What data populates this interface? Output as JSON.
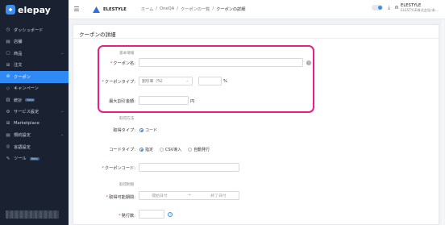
{
  "sidebar": {
    "brand": "elepay",
    "items": [
      {
        "label": "ダッシュボード",
        "icon": "clock-icon"
      },
      {
        "label": "店舗",
        "icon": "store-icon"
      },
      {
        "label": "商品",
        "icon": "box-icon",
        "expandable": true
      },
      {
        "label": "注文",
        "icon": "cart-icon"
      },
      {
        "label": "クーポン",
        "icon": "coupon-icon",
        "active": true
      },
      {
        "label": "キャンペーン",
        "icon": "tag-icon"
      },
      {
        "label": "統計",
        "icon": "chart-icon",
        "badge": "Beta"
      },
      {
        "label": "サービス設定",
        "icon": "gear-icon",
        "expandable": true
      },
      {
        "label": "Marketplace",
        "icon": "grid-icon"
      },
      {
        "label": "規約設定",
        "icon": "doc-icon",
        "expandable": true
      },
      {
        "label": "言語設定",
        "icon": "globe-icon"
      },
      {
        "label": "ツール",
        "icon": "wrench-icon",
        "badge": "Beta"
      }
    ]
  },
  "topbar": {
    "brand": "ELESTYLE",
    "breadcrumbs": [
      "ホーム",
      "/",
      "OneQA",
      "/",
      "クーポンの一覧",
      "/",
      "クーポンの詳細"
    ],
    "user_name": "ELESTYLE",
    "user_sub": "ELESTYLE株式会社(本..."
  },
  "page": {
    "title": "クーポンの詳細",
    "basic_section": "基本情報",
    "coupon_name_label": "クーポン名",
    "coupon_name_placeholder": "",
    "coupon_type_label": "クーポンタイプ",
    "coupon_type_value": "割引率（%）",
    "percent_suffix": "%",
    "max_discount_label": "最大割引金額",
    "yen_suffix": "円",
    "acquire_section": "取得方法",
    "acquire_type_label": "取得タイプ",
    "acquire_type_option": "コード",
    "code_type_label": "コードタイプ",
    "code_type_options": [
      "指定",
      "CSV導入",
      "自動発行"
    ],
    "coupon_code_label": "クーポンコード",
    "limit_section": "取得制限",
    "period_label": "取得可能期間",
    "start_placeholder": "開始日付",
    "range_sep": "→",
    "end_placeholder": "終了日付",
    "issue_count_label": "発行数"
  },
  "colors": {
    "sidebar_bg": "#1a2232",
    "active": "#2f8af5",
    "highlight": "#e91e8a",
    "required": "#e84a5f"
  }
}
